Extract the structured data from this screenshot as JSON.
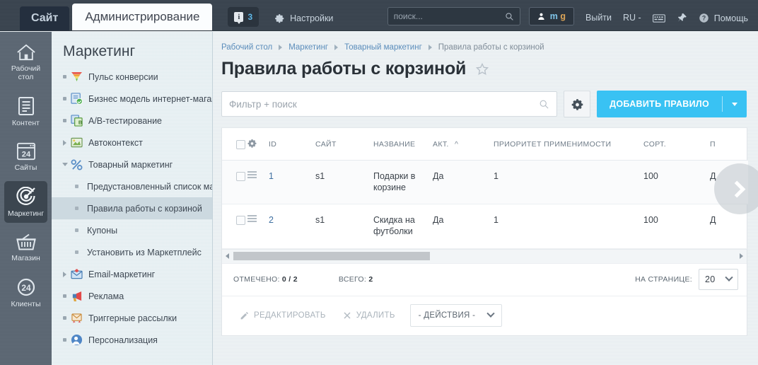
{
  "topbar": {
    "tab_site": "Сайт",
    "tab_admin": "Администрирование",
    "notif_count": "3",
    "notif_icon": "info-bubble-icon",
    "settings_label": "Настройки",
    "search_placeholder": "поиск...",
    "search_value": "",
    "user_first": "m",
    "user_second": "g",
    "logout_label": "Выйти",
    "lang_label": "RU -",
    "keyboard_icon": "keyboard-icon",
    "pin_icon": "pin-icon",
    "help_label": "Помощь"
  },
  "rail": {
    "items": [
      {
        "label": "Рабочий стол",
        "icon": "home-icon",
        "active": false
      },
      {
        "label": "Контент",
        "icon": "document-icon",
        "active": false
      },
      {
        "label": "Сайты",
        "icon": "window-24-icon",
        "active": false
      },
      {
        "label": "Маркетинг",
        "icon": "target-icon",
        "active": true
      },
      {
        "label": "Магазин",
        "icon": "basket-icon",
        "active": false
      },
      {
        "label": "Клиенты",
        "icon": "clients-24-icon",
        "active": false
      }
    ]
  },
  "nav": {
    "title": "Маркетинг",
    "items": [
      {
        "label": "Пульс конверсии",
        "icon": "funnel-icon",
        "marker": "dot",
        "child": false,
        "selected": false
      },
      {
        "label": "Бизнес модель интернет-магаз",
        "icon": "business-model-icon",
        "marker": "dot",
        "child": false,
        "selected": false
      },
      {
        "label": "A/B-тестирование",
        "icon": "ab-test-icon",
        "marker": "dot",
        "child": false,
        "selected": false
      },
      {
        "label": "Автоконтекст",
        "icon": "autocontext-icon",
        "marker": "tri",
        "child": false,
        "selected": false
      },
      {
        "label": "Товарный маркетинг",
        "icon": "percent-icon",
        "marker": "tri-down",
        "child": false,
        "selected": false
      },
      {
        "label": "Предустановленный список ма",
        "icon": "",
        "marker": "",
        "child": true,
        "selected": false
      },
      {
        "label": "Правила работы с корзиной",
        "icon": "",
        "marker": "",
        "child": true,
        "selected": true
      },
      {
        "label": "Купоны",
        "icon": "",
        "marker": "",
        "child": true,
        "selected": false
      },
      {
        "label": "Установить из Маркетплейс",
        "icon": "",
        "marker": "",
        "child": true,
        "selected": false
      },
      {
        "label": "Email-маркетинг",
        "icon": "email-marketing-icon",
        "marker": "tri",
        "child": false,
        "selected": false
      },
      {
        "label": "Реклама",
        "icon": "megaphone-icon",
        "marker": "dot",
        "child": false,
        "selected": false
      },
      {
        "label": "Триггерные рассылки",
        "icon": "trigger-mail-icon",
        "marker": "dot",
        "child": false,
        "selected": false
      },
      {
        "label": "Персонализация",
        "icon": "personalization-icon",
        "marker": "dot",
        "child": false,
        "selected": false
      }
    ]
  },
  "content": {
    "breadcrumb": [
      {
        "label": "Рабочий стол",
        "last": false
      },
      {
        "label": "Маркетинг",
        "last": false
      },
      {
        "label": "Товарный маркетинг",
        "last": false
      },
      {
        "label": "Правила работы с корзиной",
        "last": true
      }
    ],
    "page_title": "Правила работы с корзиной",
    "favorite_icon": "star-icon",
    "filter_placeholder": "Фильтр + поиск",
    "filter_value": "",
    "search_icon": "search-icon",
    "grid_settings_icon": "gear-icon",
    "add_button": "ДОБАВИТЬ ПРАВИЛО",
    "next_page_icon": "chevron-right-icon"
  },
  "grid": {
    "columns": [
      {
        "key": "check",
        "label": ""
      },
      {
        "key": "gear",
        "label": ""
      },
      {
        "key": "id",
        "label": "ID"
      },
      {
        "key": "site",
        "label": "САЙТ"
      },
      {
        "key": "name",
        "label": "НАЗВАНИЕ"
      },
      {
        "key": "act",
        "label": "АКТ.",
        "sorted": "asc"
      },
      {
        "key": "priority",
        "label": "ПРИОРИТЕТ ПРИМЕНИМОСТИ"
      },
      {
        "key": "sort",
        "label": "СОРТ."
      },
      {
        "key": "partial",
        "label": "П"
      }
    ],
    "rows": [
      {
        "id": "1",
        "site": "s1",
        "name": "Подарки в корзине",
        "act": "Да",
        "priority": "1",
        "sort": "100",
        "partial": "Д"
      },
      {
        "id": "2",
        "site": "s1",
        "name": "Скидка на футболки",
        "act": "Да",
        "priority": "1",
        "sort": "100",
        "partial": "Д"
      }
    ],
    "footer": {
      "checked_label": "ОТМЕЧЕНО:",
      "checked_value": "0 / 2",
      "total_label": "ВСЕГО:",
      "total_value": "2",
      "perpage_label": "НА СТРАНИЦЕ:",
      "perpage_value": "20",
      "edit_label": "РЕДАКТИРОВАТЬ",
      "delete_label": "УДАЛИТЬ",
      "actions_label": "- ДЕЙСТВИЯ -"
    }
  },
  "colors": {
    "accent": "#39c2f3",
    "topbar": "#39444f",
    "rail": "#5c6773",
    "nav": "#e4eef2",
    "link": "#3e6fa0"
  }
}
